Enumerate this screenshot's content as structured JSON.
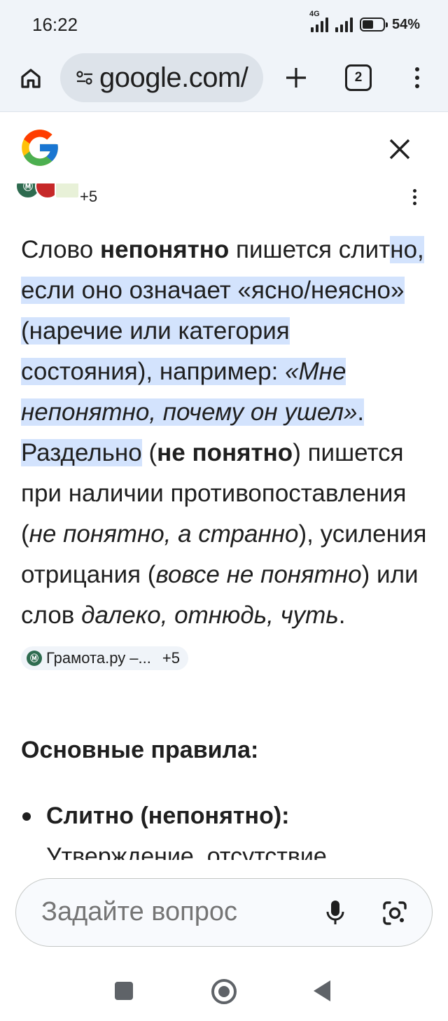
{
  "status_bar": {
    "time": "16:22",
    "network_label": "4G",
    "battery_percent": "54%",
    "battery_level": 0.54
  },
  "browser": {
    "url": "google.com/",
    "tab_count": "2",
    "icons": {
      "home": "home-icon",
      "tune": "tune-icon",
      "new_tab": "plus-icon",
      "menu": "more-vert-icon"
    }
  },
  "header": {
    "logo": "google-g-logo",
    "close": "close-icon"
  },
  "sources_row": {
    "count": "+5"
  },
  "answer": {
    "p1_a": "Слово ",
    "p1_bold": "непонятно",
    "p1_b": " пишется слит",
    "p1_hl1": "но, если оно означает «ясно/неясно» (наречие или категория состояния), например: ",
    "p1_hl_italic": "«Мне непонятно, почему он ушел»",
    "p1_hl2": ". Раздельно",
    "p1_c": " (",
    "p1_bold2": "не понятно",
    "p1_d": ") пишется при наличии противопоставления (",
    "p1_i1": "не понятно, а странно",
    "p1_e": "), усиления отрицания (",
    "p1_i2": "вовсе не понятно",
    "p1_f": ") или слов ",
    "p1_i3": "далеко, отнюдь, чуть",
    "p1_g": ". ",
    "chip_label": "Грамота.ру –...",
    "chip_count": "+5"
  },
  "section": {
    "title": "Основные правила:"
  },
  "rules": {
    "item1_bold": "Слитно (непонятно):",
    "item1_text": " Утверждение, отсутствие"
  },
  "ask_bar": {
    "placeholder": "Задайте вопрос"
  }
}
